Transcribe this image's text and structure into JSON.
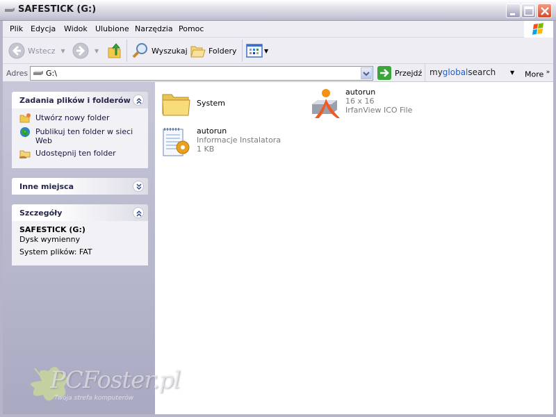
{
  "window": {
    "title": "SAFESTICK (G:)",
    "controls": {
      "minimize": "minimize",
      "maximize": "maximize",
      "close": "close"
    }
  },
  "menubar": {
    "items": [
      {
        "label": "Plik",
        "accel": "P"
      },
      {
        "label": "Edycja",
        "accel": "E"
      },
      {
        "label": "Widok",
        "accel": "W"
      },
      {
        "label": "Ulubione",
        "accel": "U"
      },
      {
        "label": "Narzędzia",
        "accel": "N"
      },
      {
        "label": "Pomoc",
        "accel": "c"
      }
    ]
  },
  "toolbar": {
    "back_label": "Wstecz",
    "search_label": "Wyszukaj",
    "folders_label": "Foldery"
  },
  "addressbar": {
    "label": "Adres",
    "value": "G:\\",
    "go_label": "Przejdź",
    "search_brand": {
      "my": "my",
      "global": "global",
      "search": "search"
    },
    "more_label": "More"
  },
  "sidebar": {
    "tasks": {
      "title": "Zadania plików i folderów",
      "items": [
        {
          "label": "Utwórz nowy folder",
          "icon": "new-folder-icon"
        },
        {
          "label": "Publikuj ten folder w sieci Web",
          "icon": "publish-web-icon"
        },
        {
          "label": "Udostępnij ten folder",
          "icon": "share-folder-icon"
        }
      ]
    },
    "other_places": {
      "title": "Inne miejsca"
    },
    "details": {
      "title": "Szczegóły",
      "name": "SAFESTICK (G:)",
      "type": "Dysk wymienny",
      "filesystem": "System plików: FAT"
    }
  },
  "files": [
    {
      "name": "System",
      "type": "folder"
    },
    {
      "name": "autorun",
      "line2": "16 x 16",
      "line3": "IrfanView ICO File",
      "type": "ico"
    },
    {
      "name": "autorun",
      "line2": "Informacje Instalatora",
      "line3": "1 KB",
      "type": "inf"
    }
  ],
  "watermark": {
    "text": "PCFoster.pl",
    "tagline": "Twoja strefa komputerów"
  },
  "colors": {
    "sidebar_bg": "#b4b4cc",
    "link_text": "#161640",
    "close_button": "#d5492a",
    "go_green": "#3aa53a",
    "brand_blue": "#1a5fd0"
  }
}
